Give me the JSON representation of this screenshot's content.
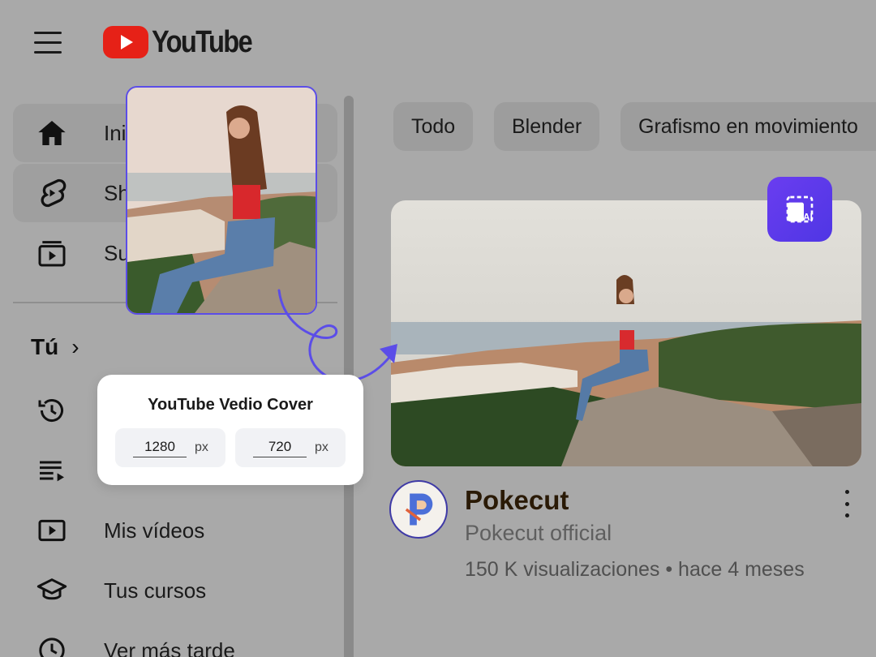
{
  "header": {
    "logo_text": "YouTube"
  },
  "sidebar": {
    "items": [
      {
        "label": "Ini",
        "icon": "home-icon"
      },
      {
        "label": "Sh",
        "icon": "shorts-icon"
      },
      {
        "label": "Su",
        "icon": "subscriptions-icon"
      }
    ],
    "you_section": {
      "label": "Tú",
      "chevron": "›"
    },
    "you_items": [
      {
        "label": "",
        "icon": "history-icon"
      },
      {
        "label": "",
        "icon": "playlists-icon"
      },
      {
        "label": "Mis vídeos",
        "icon": "your-videos-icon"
      },
      {
        "label": "Tus cursos",
        "icon": "courses-icon"
      },
      {
        "label": "Ver más tarde",
        "icon": "watch-later-icon"
      }
    ]
  },
  "chips": [
    "Todo",
    "Blender",
    "Grafismo en movimiento"
  ],
  "popover": {
    "title": "YouTube Vedio Cover",
    "width_value": "1280",
    "height_value": "720",
    "unit": "px"
  },
  "video": {
    "title": "Pokecut",
    "channel": "Pokecut official",
    "meta": "150 K visualizaciones • hace 4 meses"
  },
  "colors": {
    "accent": "#5b4de8",
    "youtube_red": "#e62117",
    "badge": "#5a39ea"
  }
}
